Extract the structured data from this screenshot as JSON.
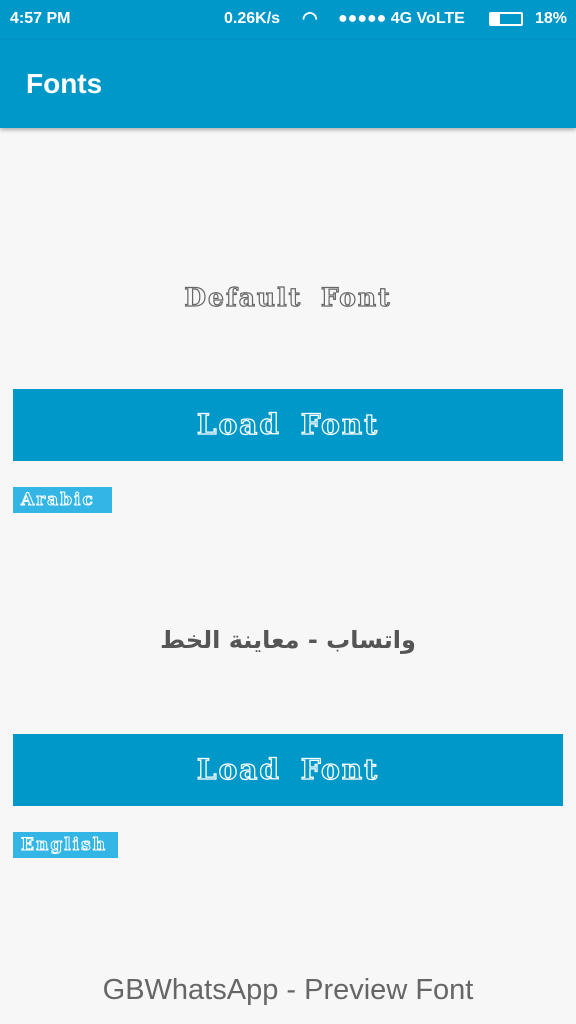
{
  "status_bar": {
    "time": "4:57 PM",
    "speed": "0.26K/s",
    "signal": "●●●●● 4G VoLTE",
    "battery": "18%",
    "battery_level": 0.18
  },
  "app_bar": {
    "title": "Fonts"
  },
  "english_section": {
    "preview": "Default Font",
    "load_button": "Load Font",
    "tag": "Arabic"
  },
  "arabic_section": {
    "preview": "واتساب - معاينة الخط",
    "load_button": "Load Font",
    "tag": "English"
  },
  "footer": "GBWhatsApp - Preview Font",
  "colors": {
    "primary": "#0098c9",
    "tag": "#33b5e5",
    "background": "#f7f7f7"
  }
}
